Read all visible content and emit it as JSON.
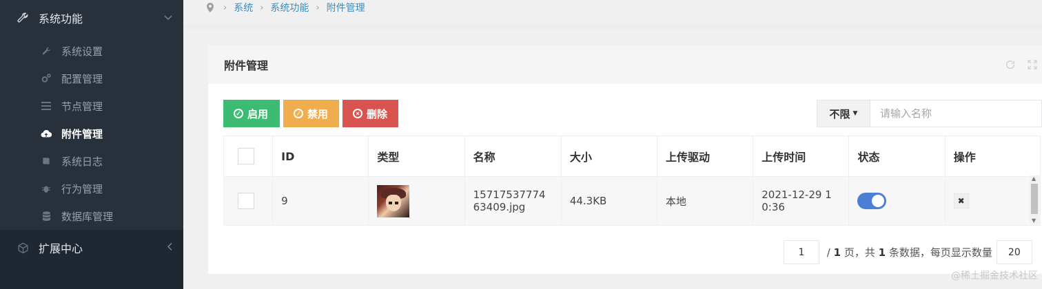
{
  "sidebar": {
    "groups": [
      {
        "label": "系统功能",
        "icon": "wrench-icon",
        "expanded": true
      },
      {
        "label": "扩展中心",
        "icon": "cubes-icon",
        "expanded": false
      }
    ],
    "items": [
      {
        "label": "系统设置",
        "icon": "wrench-icon"
      },
      {
        "label": "配置管理",
        "icon": "cogs-icon"
      },
      {
        "label": "节点管理",
        "icon": "list-icon"
      },
      {
        "label": "附件管理",
        "icon": "cloud-upload-icon",
        "active": true
      },
      {
        "label": "系统日志",
        "icon": "book-icon"
      },
      {
        "label": "行为管理",
        "icon": "bug-icon"
      },
      {
        "label": "数据库管理",
        "icon": "database-icon"
      }
    ]
  },
  "breadcrumb": [
    "系统",
    "系统功能",
    "附件管理"
  ],
  "panel": {
    "title": "附件管理"
  },
  "toolbar": {
    "enable_label": "启用",
    "disable_label": "禁用",
    "delete_label": "删除"
  },
  "search": {
    "filter_label": "不限",
    "placeholder": "请输入名称"
  },
  "table": {
    "headers": [
      "ID",
      "类型",
      "名称",
      "大小",
      "上传驱动",
      "上传时间",
      "状态",
      "操作"
    ],
    "rows": [
      {
        "id": "9",
        "name_line1": "15717537774",
        "name_line2": "63409.jpg",
        "size": "44.3KB",
        "driver": "本地",
        "time_line1": "2021-12-29 1",
        "time_line2": "0:36",
        "status_on": true
      }
    ]
  },
  "pager": {
    "current": "1",
    "total_pages": "1",
    "page_unit": "页，共",
    "total_records": "1",
    "records_unit": "条数据，每页显示数量",
    "per_page": "20"
  },
  "watermark": "@稀土掘金技术社区",
  "colors": {
    "sidebar_bg": "#1f2733",
    "accent": "#3c8dbc",
    "green": "#3cbc73",
    "orange": "#f0ad4e",
    "red": "#d9534f",
    "toggle": "#4a7fd4"
  }
}
